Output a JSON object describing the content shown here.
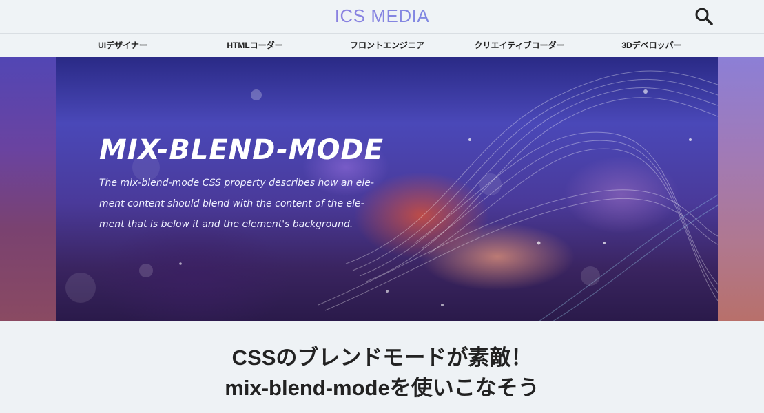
{
  "header": {
    "logo": "ICS MEDIA",
    "search_icon": "search-icon"
  },
  "nav": {
    "items": [
      {
        "label": "UIデザイナー"
      },
      {
        "label": "HTMLコーダー"
      },
      {
        "label": "フロントエンジニア"
      },
      {
        "label": "クリエイティブコーダー"
      },
      {
        "label": "3Dデベロッパー"
      }
    ]
  },
  "hero": {
    "title": "MIX-BLEND-MODE",
    "desc_lines": [
      "The mix-blend-mode CSS property describes how an ele-",
      "ment content should blend with the content of the ele-",
      "ment that is below it and the element's background."
    ]
  },
  "article": {
    "title_lines": [
      "CSSのブレンドモードが素敵！",
      "mix-blend-modeを使いこなそう"
    ]
  },
  "colors": {
    "logo_gradient_start": "#b56ad8",
    "logo_gradient_end": "#5fa0e6",
    "background": "#eef2f5",
    "text": "#222222"
  }
}
